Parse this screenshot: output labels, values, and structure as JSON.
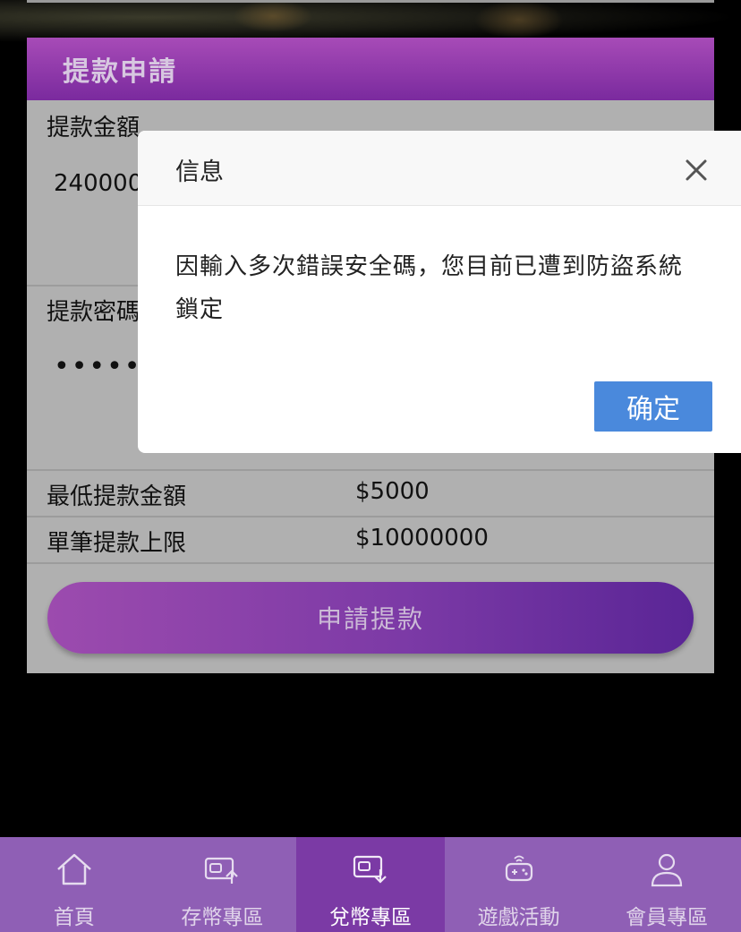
{
  "colors": {
    "panel_header_top": "#a74bb7",
    "panel_header_bottom": "#7a2a9e",
    "confirm_button": "#4a89dc",
    "nav_bg": "#8f5fb5",
    "nav_active_bg": "#7b3aa5"
  },
  "panel": {
    "title": "提款申請",
    "amount_label": "提款金額",
    "amount_value": "240000",
    "password_label": "提款密碼",
    "password_value": "••••••",
    "info_rows": [
      {
        "label": "最低提款金額",
        "value": "$5000"
      },
      {
        "label": "單筆提款上限",
        "value": "$10000000"
      }
    ],
    "apply_button": "申請提款"
  },
  "modal": {
    "title": "信息",
    "close_icon": "close-icon",
    "message_line1": "因輸入多次錯誤安全碼，您目前已遭到防盜系統",
    "message_line2": "鎖定",
    "confirm_button": "确定"
  },
  "bottom_nav": {
    "items": [
      {
        "label": "首頁",
        "icon": "home-icon",
        "active": false
      },
      {
        "label": "存幣專區",
        "icon": "deposit-icon",
        "active": false
      },
      {
        "label": "兌幣專區",
        "icon": "withdraw-icon",
        "active": true
      },
      {
        "label": "遊戲活動",
        "icon": "gamepad-icon",
        "active": false
      },
      {
        "label": "會員專區",
        "icon": "user-icon",
        "active": false
      }
    ]
  }
}
